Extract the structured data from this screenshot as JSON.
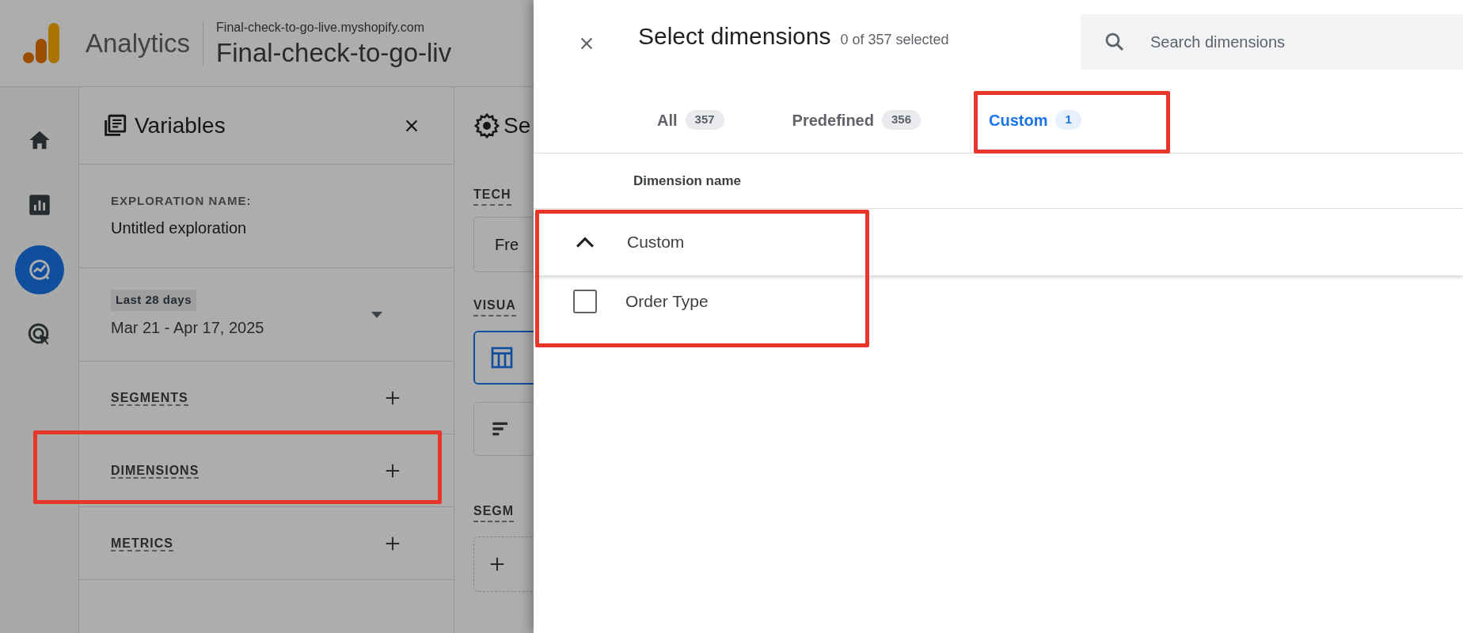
{
  "app": {
    "name": "Analytics",
    "property_url": "Final-check-to-go-live.myshopify.com",
    "property_name": "Final-check-to-go-liv"
  },
  "nav": [
    {
      "selected": false
    },
    {
      "selected": false
    },
    {
      "selected": true
    },
    {
      "selected": false
    }
  ],
  "variables": {
    "title": "Variables",
    "exploration_label": "EXPLORATION NAME:",
    "exploration_name": "Untitled exploration",
    "date_chip": "Last 28 days",
    "date_range": "Mar 21 - Apr 17, 2025",
    "sections": [
      "SEGMENTS",
      "DIMENSIONS",
      "METRICS"
    ]
  },
  "settings": {
    "title": "Se",
    "technique_label": "TECH",
    "technique_value": "Fre",
    "visualization_label": "VISUA",
    "segment_label": "SEGM"
  },
  "drawer": {
    "title": "Select dimensions",
    "count": "0 of 357 selected",
    "search_placeholder": "Search dimensions",
    "tabs": [
      {
        "label": "All",
        "count": "357",
        "selected": false
      },
      {
        "label": "Predefined",
        "count": "356",
        "selected": false
      },
      {
        "label": "Custom",
        "count": "1",
        "selected": true
      }
    ],
    "column": "Dimension name",
    "groups": [
      {
        "name": "Custom",
        "expanded": true,
        "items": [
          {
            "name": "Order Type",
            "checked": false
          }
        ]
      }
    ]
  }
}
